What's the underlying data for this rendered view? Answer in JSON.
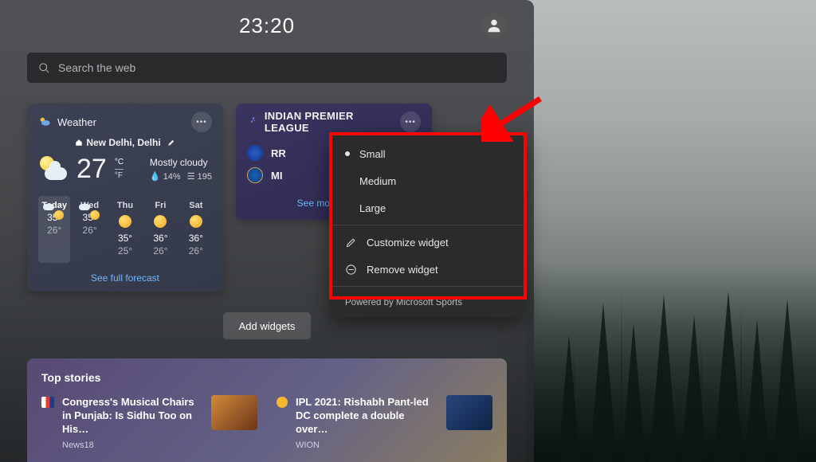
{
  "header": {
    "clock": "23:20"
  },
  "search": {
    "placeholder": "Search the web"
  },
  "weather": {
    "title": "Weather",
    "location": "New Delhi, Delhi",
    "current_temp": "27",
    "unit_c": "°C",
    "unit_f": "°F",
    "condition": "Mostly cloudy",
    "humidity": "14%",
    "aqi": "195",
    "forecast": [
      {
        "day": "Today",
        "hi": "35°",
        "lo": "26°",
        "icon": "part-cloudy"
      },
      {
        "day": "Wed",
        "hi": "35°",
        "lo": "26°",
        "icon": "part-cloudy"
      },
      {
        "day": "Thu",
        "hi": "35°",
        "lo": "25°",
        "icon": "sun"
      },
      {
        "day": "Fri",
        "hi": "36°",
        "lo": "26°",
        "icon": "sun"
      },
      {
        "day": "Sat",
        "hi": "36°",
        "lo": "26°",
        "icon": "sun"
      }
    ],
    "see_full": "See full forecast"
  },
  "sports": {
    "title": "INDIAN PREMIER LEAGUE",
    "teams": [
      {
        "abbr": "RR",
        "logo": "rr"
      },
      {
        "abbr": "MI",
        "logo": "mi"
      }
    ],
    "see_more": "See more Cricket"
  },
  "add_widgets_label": "Add widgets",
  "top_stories": {
    "title": "Top stories",
    "items": [
      {
        "headline": "Congress's Musical Chairs in Punjab: Is Sidhu Too on His…",
        "source": "News18"
      },
      {
        "headline": "IPL 2021: Rishabh Pant-led DC complete a double over…",
        "source": "WION"
      }
    ]
  },
  "context_menu": {
    "sizes": {
      "small": "Small",
      "medium": "Medium",
      "large": "Large"
    },
    "customize": "Customize widget",
    "remove": "Remove widget",
    "powered_by": "Powered by Microsoft Sports"
  }
}
